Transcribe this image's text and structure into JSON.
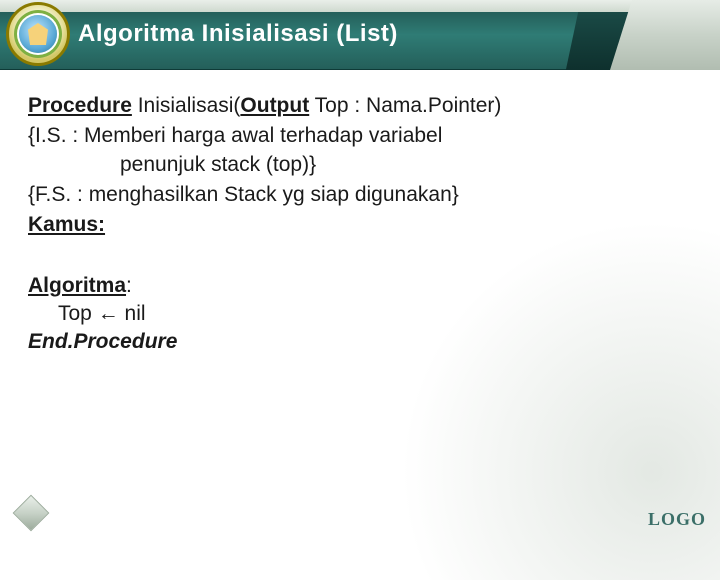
{
  "header": {
    "title": "Algoritma Inisialisasi (List)"
  },
  "body": {
    "procedure_kw": "Procedure",
    "procedure_name": " Inisialisasi(",
    "output_kw": "Output",
    "procedure_tail": "  Top : Nama.Pointer)",
    "is_line": "{I.S. : Memberi harga awal terhadap variabel",
    "is_cont": "penunjuk stack (top)}",
    "fs_line": "{F.S. : menghasilkan Stack yg siap digunakan}",
    "kamus_label": "Kamus:",
    "algoritma_label": "Algoritma",
    "algoritma_colon": ":",
    "assign_line": "Top  ←  nil",
    "end_proc": "End.Procedure"
  },
  "footer": {
    "logo_text": "LOGO"
  }
}
